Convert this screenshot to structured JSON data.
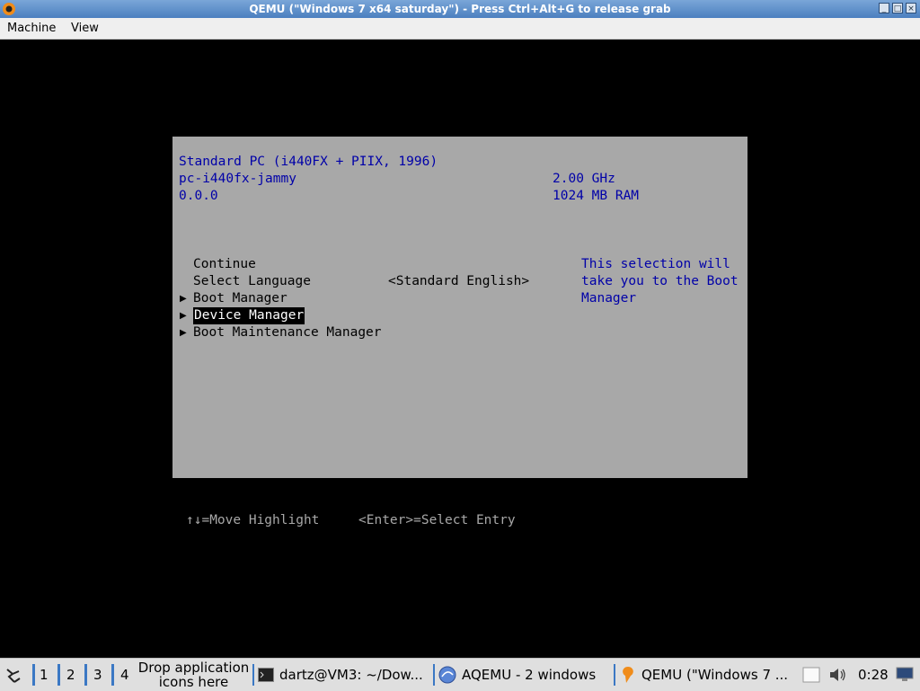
{
  "window": {
    "title": "QEMU (\"Windows 7 x64 saturday\") - Press Ctrl+Alt+G to release grab",
    "menu": [
      "Machine",
      "View"
    ]
  },
  "bios": {
    "system_name": "Standard PC (i440FX + PIIX, 1996)",
    "machine_type": "pc-i440fx-jammy",
    "version": "0.0.0",
    "cpu_speed": "2.00 GHz",
    "memory": "1024 MB RAM",
    "menu": {
      "continue": "Continue",
      "select_language": "Select Language",
      "language_value": "<Standard English>",
      "boot_manager": "Boot Manager",
      "device_manager": "Device Manager",
      "boot_maintenance": "Boot Maintenance Manager"
    },
    "help_lines": [
      "This selection will",
      "take you to the Boot",
      "Manager"
    ],
    "hint_move": "↑↓=Move Highlight",
    "hint_select": "<Enter>=Select Entry"
  },
  "taskbar": {
    "desktops": [
      "1",
      "2",
      "3",
      "4"
    ],
    "launcher_line1": "Drop application",
    "launcher_line2": "icons here",
    "tasks": [
      {
        "label": "dartz@VM3: ~/Dow...",
        "icon": "terminal-icon"
      },
      {
        "label": "AQEMU - 2 windows",
        "icon": "aqemu-icon"
      },
      {
        "label": "QEMU (\"Windows 7 ...",
        "icon": "qemu-icon"
      }
    ],
    "clock": "0:28"
  },
  "colors": {
    "bios_background": "#a8a8a8",
    "bios_text_blue": "#0000a8",
    "titlebar": "#5a8ccc",
    "taskbar_accent": "#3b78c4"
  }
}
